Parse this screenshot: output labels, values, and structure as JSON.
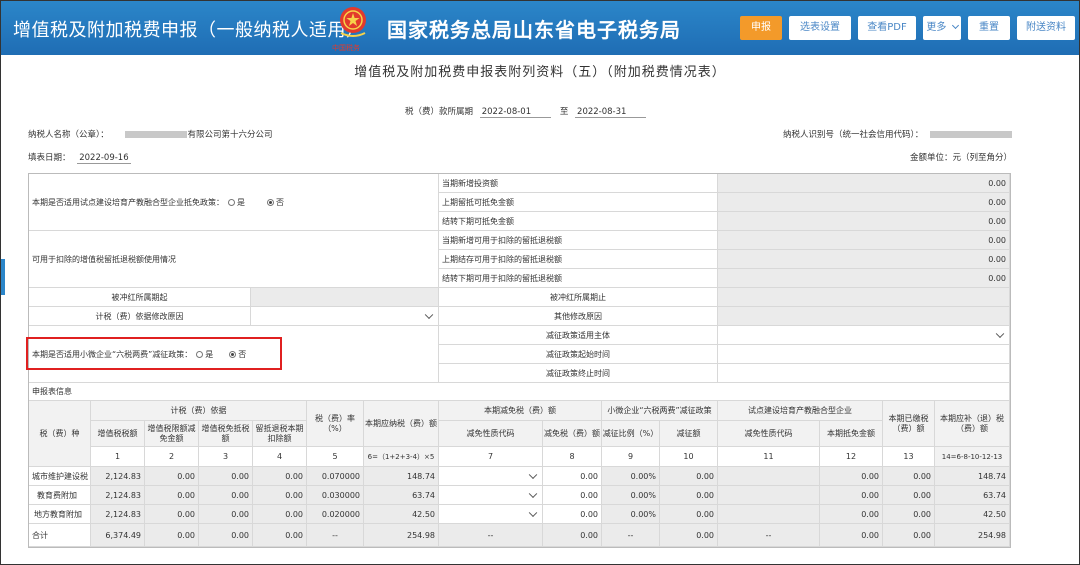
{
  "header": {
    "app_title": "增值税及附加税费申报（一般纳税人适用）",
    "bureau_name": "国家税务总局山东省电子税务局",
    "emblem_caption": "中国税务",
    "buttons": {
      "declare": "申报",
      "report_settings": "选表设置",
      "view_pdf": "查看PDF",
      "more": "更多",
      "reset": "重置",
      "attach": "附送资料"
    }
  },
  "form": {
    "title": "增值税及附加税费申报表附列资料（五）（附加税费情况表）",
    "period_label": "税（费）款所属期",
    "period_start": "2022-08-01",
    "period_to": "至",
    "period_end": "2022-08-31",
    "taxpayer_name_label": "纳税人名称（公章）：",
    "taxpayer_name_visible": "有限公司第十六分公司",
    "taxpayer_id_label": "纳税人识别号（统一社会信用代码）：",
    "fill_date_label": "填表日期：",
    "fill_date": "2022-09-16",
    "unit_label": "金额单位：元（列至角分）"
  },
  "top": {
    "q_pilot": "本期是否适用试点建设培育产教融合型企业抵免政策：",
    "yes": "是",
    "no": "否",
    "pilot_items": [
      "当期新增投资额",
      "上期留抵可抵免金额",
      "结转下期可抵免金额"
    ],
    "pilot_values": [
      "0.00",
      "0.00",
      "0.00"
    ],
    "deduct_label": "可用于扣除的增值税留抵退税额使用情况",
    "deduct_items": [
      "当期新增可用于扣除的留抵退税额",
      "上期结存可用于扣除的留抵退税额",
      "结转下期可用于扣除的留抵退税额"
    ],
    "deduct_values": [
      "0.00",
      "0.00",
      "0.00"
    ],
    "offset_start": "被冲红所属期起",
    "offset_end": "被冲红所属期止",
    "modify_reason": "计税（费）依据修改原因",
    "other_reason": "其他修改原因",
    "q_sme": "本期是否适用小微企业“六税两费”减征政策：",
    "policy_subject": "减征政策适用主体",
    "policy_start": "减征政策起始时间",
    "policy_end": "减征政策终止时间"
  },
  "table": {
    "section_title": "申报表信息",
    "h_tax_type": "税（费）种",
    "h_basis": "计税（费）依据",
    "h_vat": "增值税税额",
    "h_vat_credit": "增值税限额减免金额",
    "h_vat_exempt": "增值税免抵税额",
    "h_refund_deduct": "留抵退税本期扣除额",
    "h_rate": "税（费）率（%）",
    "h_payable": "本期应纳税（费）额",
    "h_reduce": "本期减免税（费）额",
    "h_reduce_code": "减免性质代码",
    "h_reduce_amt": "减免税（费）额",
    "h_sme": "小微企业“六税两费”减征政策",
    "h_sme_ratio": "减征比例（%）",
    "h_sme_amt": "减征额",
    "h_pilot": "试点建设培育产教融合型企业",
    "h_pilot_code": "减免性质代码",
    "h_pilot_amt": "本期抵免金额",
    "h_paid": "本期已缴税（费）额",
    "h_due": "本期应补（退）税（费）额",
    "col_nums": [
      "1",
      "2",
      "3",
      "4",
      "5",
      "6=（1+2+3-4）×5",
      "7",
      "8",
      "9",
      "10",
      "11",
      "12",
      "13",
      "14=6-8-10-12-13"
    ],
    "rows": [
      {
        "name": "城市维护建设税",
        "c1": "2,124.83",
        "c2": "0.00",
        "c3": "0.00",
        "c4": "0.00",
        "c5": "0.070000",
        "c6": "148.74",
        "c8": "0.00",
        "c9": "0.00%",
        "c10": "0.00",
        "c12": "0.00",
        "c13": "0.00",
        "c14": "148.74"
      },
      {
        "name": "教育费附加",
        "c1": "2,124.83",
        "c2": "0.00",
        "c3": "0.00",
        "c4": "0.00",
        "c5": "0.030000",
        "c6": "63.74",
        "c8": "0.00",
        "c9": "0.00%",
        "c10": "0.00",
        "c12": "0.00",
        "c13": "0.00",
        "c14": "63.74"
      },
      {
        "name": "地方教育附加",
        "c1": "2,124.83",
        "c2": "0.00",
        "c3": "0.00",
        "c4": "0.00",
        "c5": "0.020000",
        "c6": "42.50",
        "c8": "0.00",
        "c9": "0.00%",
        "c10": "0.00",
        "c12": "0.00",
        "c13": "0.00",
        "c14": "42.50"
      }
    ],
    "total": {
      "name": "合计",
      "c1": "6,374.49",
      "c2": "0.00",
      "c3": "0.00",
      "c4": "0.00",
      "c5": "--",
      "c6": "254.98",
      "c7": "--",
      "c8": "0.00",
      "c9": "--",
      "c10": "0.00",
      "c11": "--",
      "c12": "0.00",
      "c13": "0.00",
      "c14": "254.98"
    }
  }
}
